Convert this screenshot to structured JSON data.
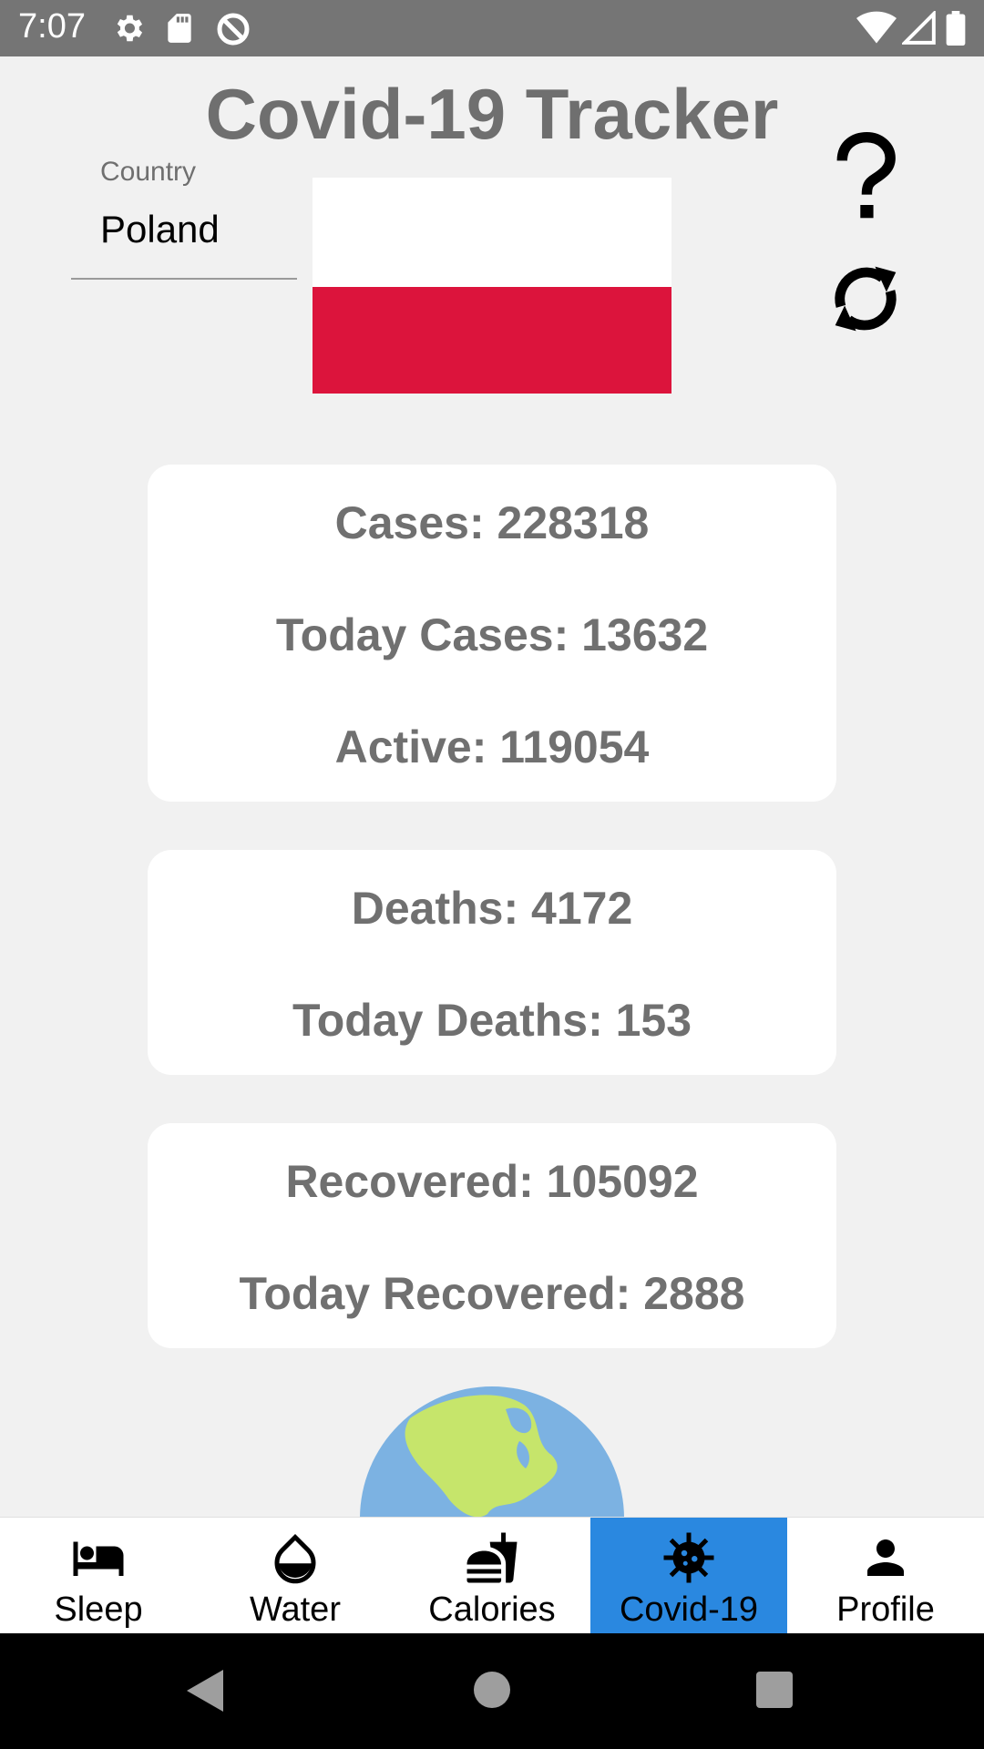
{
  "status_bar": {
    "time": "7:07",
    "icons": [
      "settings-icon",
      "sd-card-icon",
      "data-saver-icon",
      "wifi-icon",
      "signal-icon",
      "battery-icon"
    ]
  },
  "app": {
    "title": "Covid-19 Tracker"
  },
  "country": {
    "label": "Country",
    "value": "Poland"
  },
  "flag": {
    "colors": [
      "#ffffff",
      "#dc143c"
    ]
  },
  "actions": {
    "help_icon": "help-icon",
    "refresh_icon": "refresh-icon"
  },
  "stats": {
    "cases": "Cases: 228318",
    "today_cases": "Today Cases: 13632",
    "active": "Active: 119054",
    "deaths": "Deaths: 4172",
    "today_deaths": "Today Deaths: 153",
    "recovered": "Recovered: 105092",
    "today_recovered": "Today Recovered: 2888"
  },
  "bottom_nav": {
    "active_color": "#2a88e0",
    "items": [
      {
        "label": "Sleep",
        "icon": "bed-icon"
      },
      {
        "label": "Water",
        "icon": "water-drop-icon"
      },
      {
        "label": "Calories",
        "icon": "fastfood-icon"
      },
      {
        "label": "Covid-19",
        "icon": "virus-icon",
        "active": true
      },
      {
        "label": "Profile",
        "icon": "person-icon"
      }
    ]
  },
  "system_nav": {
    "icons": [
      "back-icon",
      "home-icon",
      "recents-icon"
    ]
  }
}
